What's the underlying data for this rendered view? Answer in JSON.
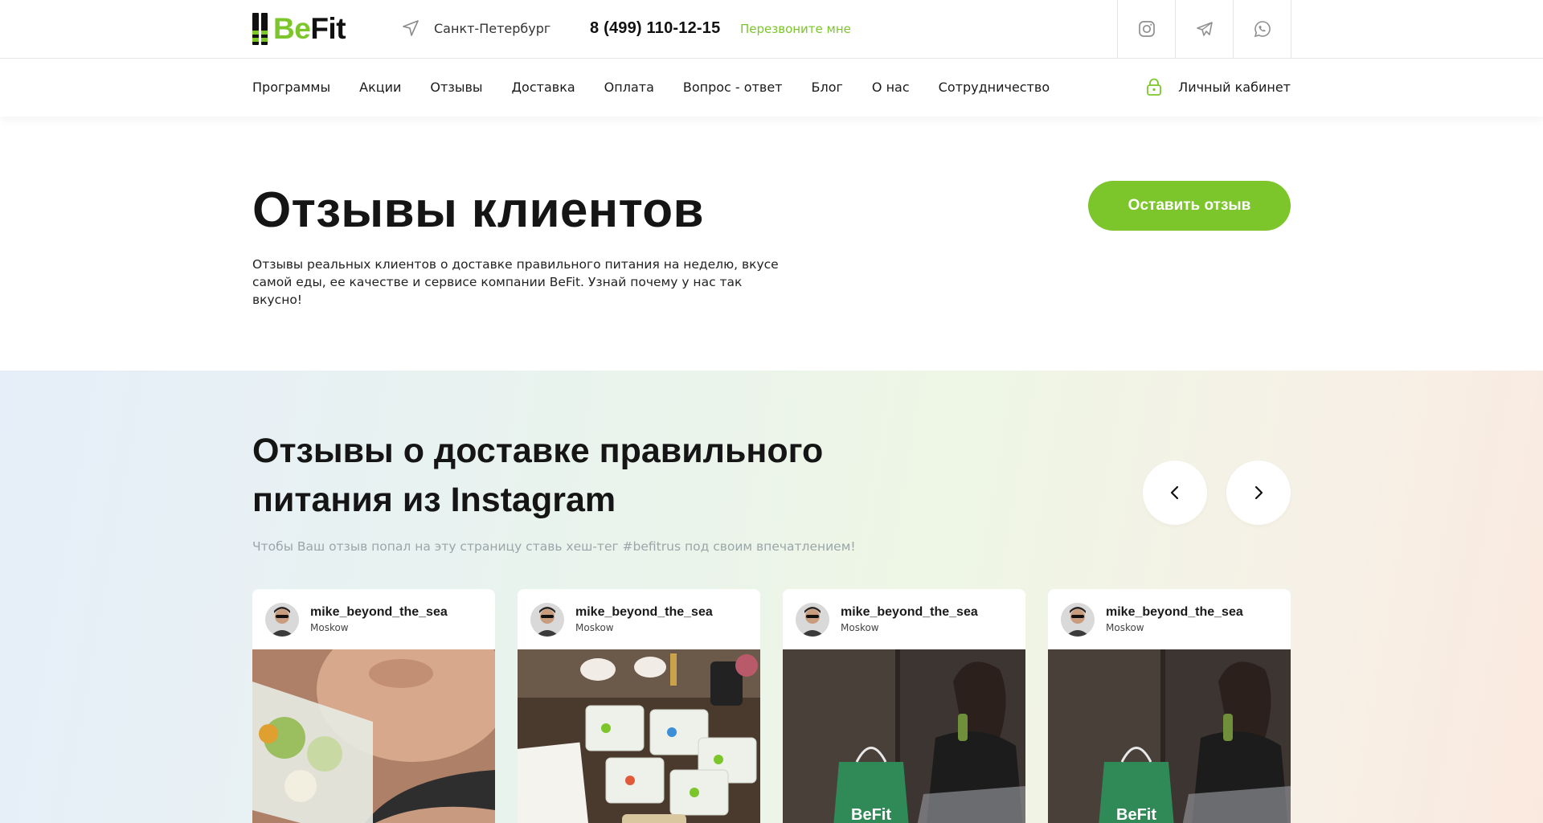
{
  "brand": {
    "logo_be": "Be",
    "logo_fit": "Fit",
    "accent": "#7cc62c"
  },
  "header": {
    "city": "Санкт-Петербург",
    "phone": "8 (499) 110-12-15",
    "callback": "Перезвоните мне",
    "socials": [
      "instagram-icon",
      "telegram-icon",
      "whatsapp-icon"
    ]
  },
  "nav": {
    "items": [
      "Программы",
      "Акции",
      "Отзывы",
      "Доставка",
      "Оплата",
      "Вопрос - ответ",
      "Блог",
      "О нас",
      "Сотрудничество"
    ],
    "account": "Личный кабинет"
  },
  "hero": {
    "title": "Отзывы клиентов",
    "description": "Отзывы реальных клиентов о доставке правильного питания на неделю, вкусе самой еды, ее качестве и сервисе компании BeFit. Узнай почему у нас так вкусно!",
    "cta": "Оставить отзыв"
  },
  "reviews": {
    "title": "Отзывы о доставке правильного питания из Instagram",
    "subtitle": "Чтобы Ваш отзыв попал на эту страницу ставь хеш-тег #befitrus под своим впечатлением!",
    "cards": [
      {
        "user": "mike_beyond_the_sea",
        "location": "Moskow"
      },
      {
        "user": "mike_beyond_the_sea",
        "location": "Moskow"
      },
      {
        "user": "mike_beyond_the_sea",
        "location": "Moskow"
      },
      {
        "user": "mike_beyond_the_sea",
        "location": "Moskow"
      }
    ],
    "bag_logo": "BeFit"
  }
}
